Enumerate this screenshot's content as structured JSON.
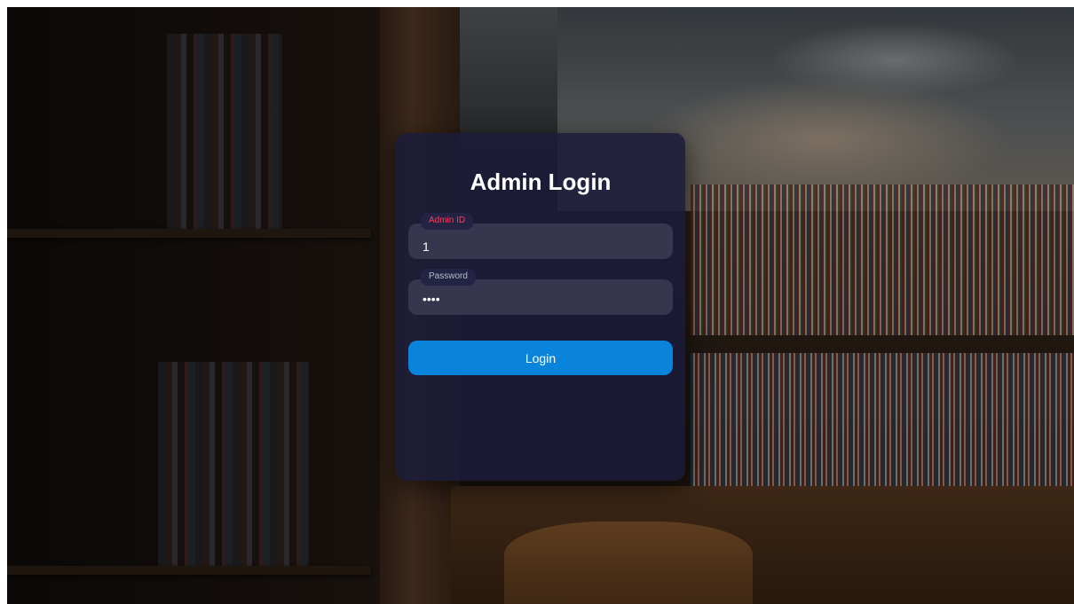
{
  "login": {
    "title": "Admin Login",
    "admin_id": {
      "label": "Admin ID",
      "value": "1"
    },
    "password": {
      "label": "Password",
      "masked_value": "••••"
    },
    "submit_label": "Login"
  },
  "colors": {
    "card_background": "#1b1b3a",
    "input_background": "#36374f",
    "active_label": "#ff3b5c",
    "button": "#0a84da"
  },
  "background": {
    "image_subject": "library-bookshelves-photo"
  }
}
